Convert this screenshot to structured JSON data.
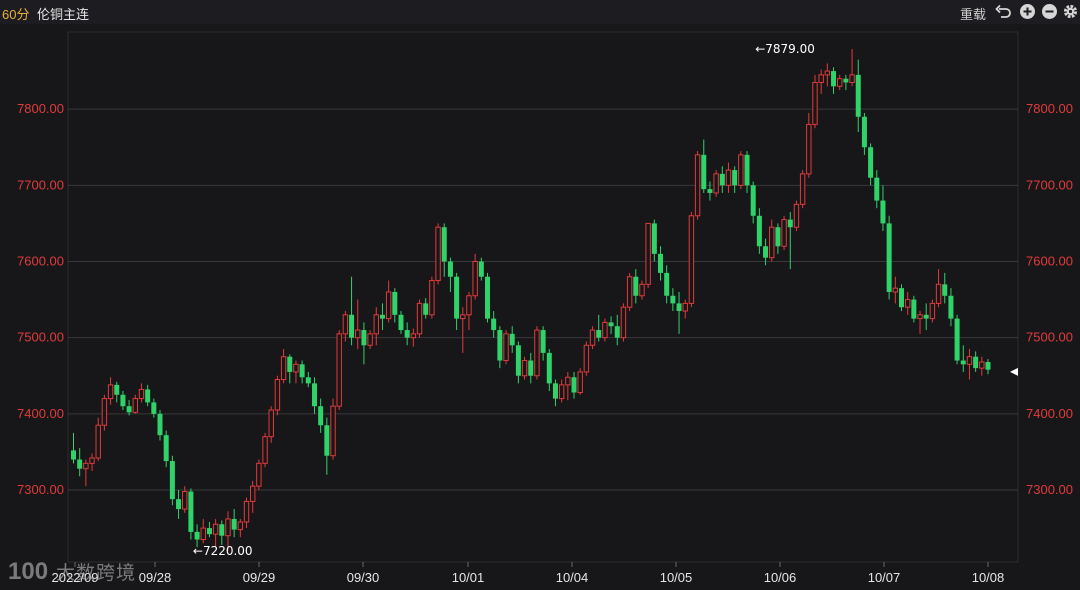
{
  "toolbar": {
    "period": "60分",
    "title": "伦铜主连",
    "reload_label": "重载",
    "icons": [
      "undo-icon",
      "zoom-in-icon",
      "zoom-out-icon",
      "gear-icon"
    ]
  },
  "watermark": {
    "text": "大数跨境"
  },
  "colors": {
    "up": "#e23a3a",
    "down": "#2fd36a",
    "axis_label": "#e03b3b",
    "grid": "#38383c",
    "background": "#17171a"
  },
  "chart_data": {
    "type": "candlestick",
    "ylim": [
      7215,
      7900
    ],
    "y_ticks": [
      "7300.00",
      "7400.00",
      "7500.00",
      "7600.00",
      "7700.00",
      "7800.00"
    ],
    "x_tick_labels": [
      "2022/09",
      "09/28",
      "09/29",
      "09/30",
      "10/01",
      "10/04",
      "10/05",
      "10/06",
      "10/07",
      "10/08"
    ],
    "annotations": [
      {
        "label": "7879.00",
        "value": 7879,
        "candle": 110
      },
      {
        "label": "7220.00",
        "value": 7220,
        "candle": 19
      }
    ],
    "last_price": 7455,
    "ohlc": [
      [
        7352,
        7375,
        7335,
        7340
      ],
      [
        7340,
        7355,
        7318,
        7328
      ],
      [
        7328,
        7340,
        7305,
        7335
      ],
      [
        7335,
        7348,
        7325,
        7342
      ],
      [
        7342,
        7395,
        7338,
        7385
      ],
      [
        7385,
        7425,
        7378,
        7420
      ],
      [
        7420,
        7448,
        7412,
        7438
      ],
      [
        7438,
        7442,
        7415,
        7425
      ],
      [
        7425,
        7430,
        7405,
        7410
      ],
      [
        7410,
        7418,
        7398,
        7402
      ],
      [
        7402,
        7425,
        7400,
        7420
      ],
      [
        7420,
        7440,
        7415,
        7432
      ],
      [
        7432,
        7438,
        7410,
        7415
      ],
      [
        7415,
        7420,
        7395,
        7400
      ],
      [
        7400,
        7405,
        7365,
        7372
      ],
      [
        7372,
        7378,
        7330,
        7338
      ],
      [
        7338,
        7345,
        7280,
        7288
      ],
      [
        7288,
        7300,
        7262,
        7275
      ],
      [
        7275,
        7305,
        7270,
        7298
      ],
      [
        7298,
        7302,
        7235,
        7245
      ],
      [
        7245,
        7255,
        7225,
        7235
      ],
      [
        7235,
        7262,
        7230,
        7250
      ],
      [
        7250,
        7258,
        7238,
        7242
      ],
      [
        7242,
        7262,
        7225,
        7255
      ],
      [
        7255,
        7260,
        7228,
        7240
      ],
      [
        7240,
        7272,
        7220,
        7262
      ],
      [
        7262,
        7275,
        7238,
        7248
      ],
      [
        7248,
        7262,
        7238,
        7258
      ],
      [
        7258,
        7290,
        7250,
        7285
      ],
      [
        7285,
        7312,
        7270,
        7305
      ],
      [
        7305,
        7340,
        7300,
        7335
      ],
      [
        7335,
        7375,
        7330,
        7370
      ],
      [
        7370,
        7410,
        7362,
        7405
      ],
      [
        7405,
        7450,
        7398,
        7445
      ],
      [
        7445,
        7485,
        7440,
        7475
      ],
      [
        7475,
        7478,
        7440,
        7455
      ],
      [
        7455,
        7470,
        7440,
        7465
      ],
      [
        7465,
        7470,
        7440,
        7448
      ],
      [
        7448,
        7455,
        7435,
        7440
      ],
      [
        7440,
        7448,
        7400,
        7410
      ],
      [
        7410,
        7420,
        7375,
        7385
      ],
      [
        7385,
        7395,
        7320,
        7345
      ],
      [
        7345,
        7420,
        7340,
        7410
      ],
      [
        7410,
        7510,
        7405,
        7505
      ],
      [
        7505,
        7535,
        7495,
        7530
      ],
      [
        7530,
        7580,
        7490,
        7500
      ],
      [
        7500,
        7550,
        7485,
        7510
      ],
      [
        7510,
        7520,
        7465,
        7490
      ],
      [
        7490,
        7510,
        7485,
        7505
      ],
      [
        7505,
        7540,
        7490,
        7530
      ],
      [
        7530,
        7545,
        7510,
        7525
      ],
      [
        7525,
        7575,
        7520,
        7560
      ],
      [
        7560,
        7565,
        7520,
        7530
      ],
      [
        7530,
        7535,
        7505,
        7510
      ],
      [
        7510,
        7520,
        7490,
        7500
      ],
      [
        7500,
        7512,
        7488,
        7505
      ],
      [
        7505,
        7550,
        7500,
        7545
      ],
      [
        7545,
        7552,
        7525,
        7530
      ],
      [
        7530,
        7580,
        7525,
        7575
      ],
      [
        7575,
        7650,
        7570,
        7645
      ],
      [
        7645,
        7650,
        7580,
        7600
      ],
      [
        7600,
        7605,
        7560,
        7580
      ],
      [
        7580,
        7585,
        7510,
        7525
      ],
      [
        7525,
        7540,
        7480,
        7530
      ],
      [
        7530,
        7560,
        7510,
        7555
      ],
      [
        7555,
        7610,
        7550,
        7600
      ],
      [
        7600,
        7605,
        7575,
        7580
      ],
      [
        7580,
        7585,
        7520,
        7525
      ],
      [
        7525,
        7535,
        7500,
        7510
      ],
      [
        7510,
        7515,
        7460,
        7470
      ],
      [
        7470,
        7510,
        7465,
        7505
      ],
      [
        7505,
        7515,
        7480,
        7490
      ],
      [
        7490,
        7495,
        7440,
        7450
      ],
      [
        7450,
        7475,
        7445,
        7470
      ],
      [
        7470,
        7480,
        7440,
        7450
      ],
      [
        7450,
        7515,
        7445,
        7510
      ],
      [
        7510,
        7515,
        7470,
        7480
      ],
      [
        7480,
        7485,
        7430,
        7440
      ],
      [
        7440,
        7445,
        7410,
        7420
      ],
      [
        7420,
        7445,
        7415,
        7438
      ],
      [
        7438,
        7455,
        7418,
        7448
      ],
      [
        7448,
        7455,
        7420,
        7428
      ],
      [
        7428,
        7460,
        7425,
        7455
      ],
      [
        7455,
        7495,
        7450,
        7490
      ],
      [
        7490,
        7515,
        7485,
        7510
      ],
      [
        7510,
        7530,
        7495,
        7500
      ],
      [
        7500,
        7525,
        7495,
        7520
      ],
      [
        7520,
        7528,
        7505,
        7515
      ],
      [
        7515,
        7530,
        7490,
        7500
      ],
      [
        7500,
        7545,
        7495,
        7540
      ],
      [
        7540,
        7585,
        7535,
        7580
      ],
      [
        7580,
        7590,
        7545,
        7555
      ],
      [
        7555,
        7575,
        7550,
        7570
      ],
      [
        7570,
        7630,
        7565,
        7650
      ],
      [
        7650,
        7655,
        7600,
        7610
      ],
      [
        7610,
        7620,
        7575,
        7585
      ],
      [
        7585,
        7595,
        7545,
        7555
      ],
      [
        7555,
        7565,
        7535,
        7545
      ],
      [
        7545,
        7560,
        7505,
        7535
      ],
      [
        7535,
        7550,
        7525,
        7545
      ],
      [
        7545,
        7665,
        7540,
        7660
      ],
      [
        7660,
        7745,
        7655,
        7740
      ],
      [
        7740,
        7760,
        7690,
        7695
      ],
      [
        7695,
        7705,
        7680,
        7690
      ],
      [
        7690,
        7720,
        7685,
        7715
      ],
      [
        7715,
        7725,
        7690,
        7700
      ],
      [
        7700,
        7730,
        7690,
        7720
      ],
      [
        7720,
        7725,
        7690,
        7700
      ],
      [
        7700,
        7745,
        7695,
        7740
      ],
      [
        7740,
        7745,
        7690,
        7700
      ],
      [
        7700,
        7705,
        7650,
        7660
      ],
      [
        7660,
        7670,
        7610,
        7620
      ],
      [
        7620,
        7630,
        7595,
        7605
      ],
      [
        7605,
        7655,
        7600,
        7645
      ],
      [
        7645,
        7650,
        7610,
        7620
      ],
      [
        7620,
        7660,
        7615,
        7655
      ],
      [
        7655,
        7665,
        7590,
        7645
      ],
      [
        7645,
        7680,
        7640,
        7675
      ],
      [
        7675,
        7720,
        7670,
        7715
      ],
      [
        7715,
        7795,
        7710,
        7780
      ],
      [
        7780,
        7845,
        7775,
        7835
      ],
      [
        7835,
        7852,
        7820,
        7845
      ],
      [
        7845,
        7860,
        7830,
        7850
      ],
      [
        7850,
        7855,
        7820,
        7830
      ],
      [
        7830,
        7845,
        7825,
        7840
      ],
      [
        7840,
        7845,
        7825,
        7835
      ],
      [
        7835,
        7879,
        7830,
        7845
      ],
      [
        7845,
        7865,
        7770,
        7790
      ],
      [
        7790,
        7795,
        7740,
        7750
      ],
      [
        7750,
        7755,
        7700,
        7710
      ],
      [
        7710,
        7720,
        7670,
        7680
      ],
      [
        7680,
        7700,
        7640,
        7650
      ],
      [
        7650,
        7660,
        7550,
        7560
      ],
      [
        7560,
        7580,
        7545,
        7565
      ],
      [
        7565,
        7570,
        7535,
        7540
      ],
      [
        7540,
        7560,
        7530,
        7550
      ],
      [
        7550,
        7555,
        7520,
        7525
      ],
      [
        7525,
        7535,
        7505,
        7530
      ],
      [
        7530,
        7545,
        7510,
        7525
      ],
      [
        7525,
        7550,
        7520,
        7545
      ],
      [
        7545,
        7590,
        7540,
        7570
      ],
      [
        7570,
        7585,
        7545,
        7555
      ],
      [
        7555,
        7565,
        7515,
        7525
      ],
      [
        7525,
        7530,
        7465,
        7470
      ],
      [
        7470,
        7490,
        7455,
        7465
      ],
      [
        7465,
        7485,
        7445,
        7475
      ],
      [
        7475,
        7482,
        7455,
        7460
      ],
      [
        7460,
        7475,
        7450,
        7468
      ],
      [
        7468,
        7472,
        7452,
        7458
      ]
    ]
  }
}
